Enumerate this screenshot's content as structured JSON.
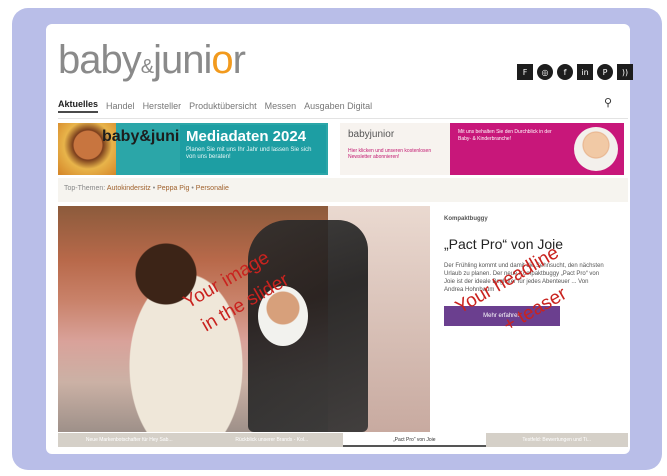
{
  "logo": {
    "pre": "baby",
    "amp": "&",
    "mid": "juni",
    "o": "o",
    "post": "r"
  },
  "social": [
    {
      "icon": "flipboard-icon",
      "glyph": "F"
    },
    {
      "icon": "instagram-icon",
      "glyph": "◎"
    },
    {
      "icon": "facebook-icon",
      "glyph": "f"
    },
    {
      "icon": "linkedin-icon",
      "glyph": "in"
    },
    {
      "icon": "pinterest-icon",
      "glyph": "P"
    },
    {
      "icon": "rss-icon",
      "glyph": "))"
    }
  ],
  "nav": {
    "items": [
      "Aktuelles",
      "Handel",
      "Hersteller",
      "Produktübersicht",
      "Messen",
      "Ausgaben Digital"
    ],
    "active_index": 0,
    "search_glyph": "⚲"
  },
  "banner_left": {
    "brand_pre": "baby&juni",
    "brand_o": "o",
    "brand_post": "r",
    "title": "Mediadaten 2024",
    "subtitle": "Planen Sie mit uns Ihr Jahr und lassen Sie sich von uns beraten!"
  },
  "banner_right": {
    "brand": "babyjunior",
    "left_text": "Hier klicken und unseren kostenlosen Newsletter abonnieren!",
    "right_text": "Mit uns behalten Sie den Durchblick in der Baby- & Kinderbranche!"
  },
  "topics": {
    "label": "Top-Themen:",
    "items": [
      "Autokindersitz",
      "Peppa Pig",
      "Personalie"
    ],
    "sep": " • "
  },
  "teaser": {
    "category": "Kompaktbuggy",
    "headline": "„Pact Pro“ von Joie",
    "text": "Der Frühling kommt und damit die Sehnsucht, den nächsten Urlaub zu planen. Der neue Kompaktbuggy „Pact Pro“ von Joie ist der ideale Begleiter für jedes Abenteuer ... Von Andrea Hohnbaum",
    "button": "Mehr erfahren"
  },
  "overlay": {
    "slider_line1": "Your image",
    "slider_line2": "in the slider",
    "teaser_line1": "Your headline",
    "teaser_line2": "+ teaser"
  },
  "tabs": [
    {
      "label": "Neue Markenbotschafter für Hey Sab..."
    },
    {
      "label": "Rückblick unserer Brands - Kol..."
    },
    {
      "label": "„Pact Pro“ von Joie"
    },
    {
      "label": "Testfeld: Bewertungen und Ti..."
    }
  ],
  "active_tab": 2
}
